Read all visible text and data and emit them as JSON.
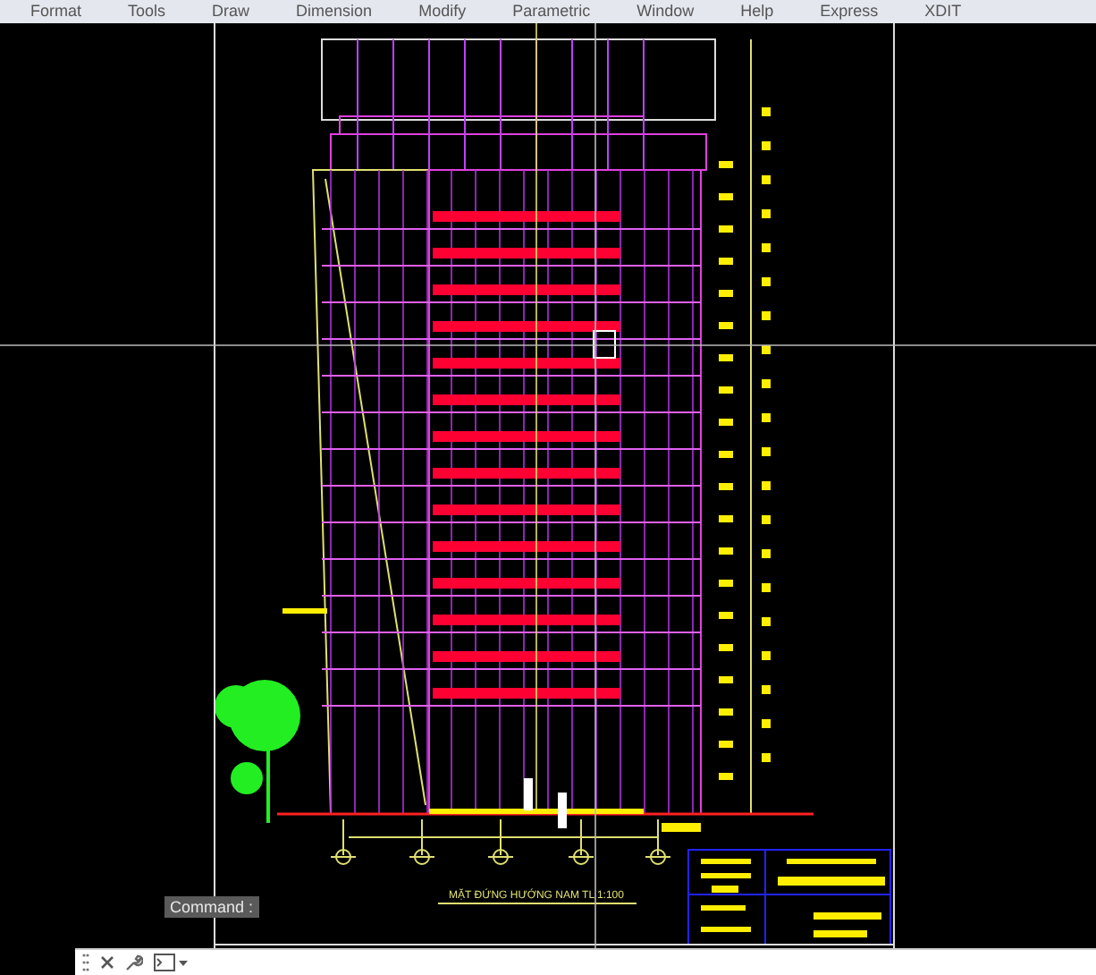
{
  "menu_bar": {
    "items": [
      "Format",
      "Tools",
      "Draw",
      "Dimension",
      "Modify",
      "Parametric",
      "Window",
      "Help",
      "Express",
      "XDIT"
    ]
  },
  "drawing": {
    "title": "MẶT ĐỨNG HƯỚNG NAM  TL 1:100"
  },
  "command_line": {
    "prompt": "Command :"
  }
}
